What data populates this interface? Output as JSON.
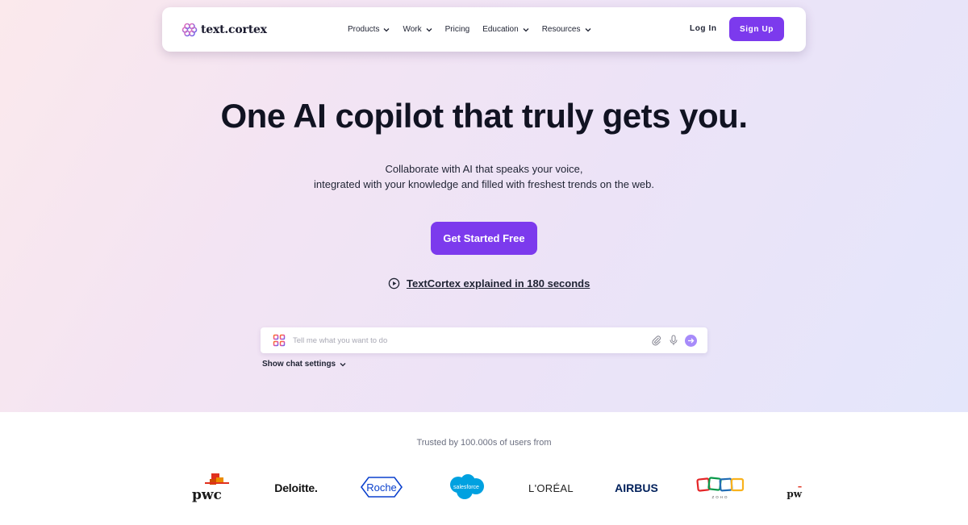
{
  "nav": {
    "logo_text": "text.cortex",
    "links": [
      {
        "label": "Products",
        "has_dropdown": true
      },
      {
        "label": "Work",
        "has_dropdown": true
      },
      {
        "label": "Pricing",
        "has_dropdown": false
      },
      {
        "label": "Education",
        "has_dropdown": true
      },
      {
        "label": "Resources",
        "has_dropdown": true
      }
    ],
    "login_label": "Log In",
    "signup_label": "Sign Up"
  },
  "hero": {
    "headline": "One AI copilot that truly gets you.",
    "subline_1": "Collaborate with AI that speaks your voice,",
    "subline_2": "integrated with your knowledge and filled with freshest trends on the web.",
    "cta_label": "Get Started Free",
    "video_link_label": "TextCortex explained in 180 seconds"
  },
  "chat": {
    "placeholder": "Tell me what you want to do",
    "value": "",
    "icons": [
      "apps-grid-icon",
      "paperclip-icon",
      "microphone-icon",
      "send-arrow-icon"
    ],
    "settings_label": "Show chat settings"
  },
  "trusted": {
    "label": "Trusted by 100.000s of users from",
    "brands": [
      "pwc",
      "Deloitte.",
      "Roche",
      "salesforce",
      "L'ORÉAL",
      "AIRBUS",
      "ZOHO",
      "pw"
    ]
  },
  "colors": {
    "accent": "#7c3aed",
    "send_button": "#a78bfa",
    "text_dark": "#111322"
  }
}
